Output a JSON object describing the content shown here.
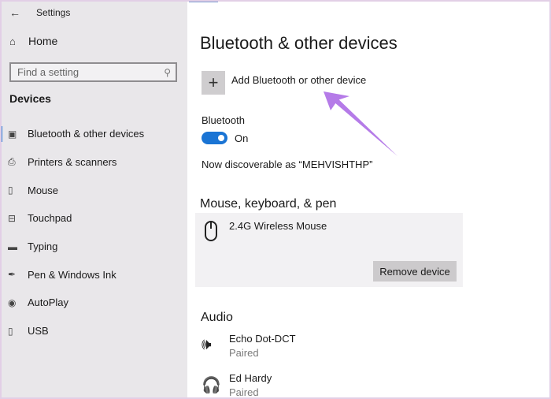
{
  "window": {
    "title": "Settings"
  },
  "sidebar": {
    "home_label": "Home",
    "search_placeholder": "Find a setting",
    "section": "Devices",
    "items": [
      {
        "label": "Bluetooth & other devices",
        "icon": "bluetooth-devices-icon",
        "glyph": "▣",
        "active": true
      },
      {
        "label": "Printers & scanners",
        "icon": "printer-icon",
        "glyph": "⎙",
        "active": false
      },
      {
        "label": "Mouse",
        "icon": "mouse-icon",
        "glyph": "▯",
        "active": false
      },
      {
        "label": "Touchpad",
        "icon": "touchpad-icon",
        "glyph": "⊟",
        "active": false
      },
      {
        "label": "Typing",
        "icon": "keyboard-icon",
        "glyph": "▬",
        "active": false
      },
      {
        "label": "Pen & Windows Ink",
        "icon": "pen-icon",
        "glyph": "✒",
        "active": false
      },
      {
        "label": "AutoPlay",
        "icon": "autoplay-icon",
        "glyph": "◉",
        "active": false
      },
      {
        "label": "USB",
        "icon": "usb-icon",
        "glyph": "▯",
        "active": false
      }
    ]
  },
  "main": {
    "title": "Bluetooth & other devices",
    "add_device_label": "Add Bluetooth or other device",
    "bluetooth": {
      "label": "Bluetooth",
      "state": "On",
      "enabled": true,
      "discoverable_text": "Now discoverable as “MEHVISHTHP”"
    },
    "input_section": {
      "title": "Mouse, keyboard, & pen",
      "devices": [
        {
          "name": "2.4G Wireless Mouse",
          "icon": "mouse-icon",
          "action": "Remove device"
        }
      ]
    },
    "audio_section": {
      "title": "Audio",
      "devices": [
        {
          "name": "Echo Dot-DCT",
          "status": "Paired",
          "icon": "speaker-icon",
          "glyph": "🕪"
        },
        {
          "name": "Ed Hardy",
          "status": "Paired",
          "icon": "headset-icon",
          "glyph": "🎧"
        }
      ]
    }
  },
  "colors": {
    "accent": "#1a74d4",
    "annotation_arrow": "#b57be8",
    "sidebar_bg": "#e9e7ea"
  }
}
